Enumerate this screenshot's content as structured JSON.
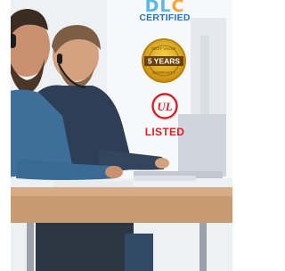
{
  "badges": {
    "dlc": {
      "logo_text": "DLC",
      "label": "CERTIFIED",
      "color": "#5db8e6"
    },
    "warranty": {
      "label": "5 YEARS",
      "arc_top": "BEST VALUE",
      "arc_bottom": "WARRANTY",
      "color": "#e8b11c"
    },
    "ul": {
      "mark": "UL",
      "label": "LISTED",
      "color": "#d72128"
    }
  }
}
